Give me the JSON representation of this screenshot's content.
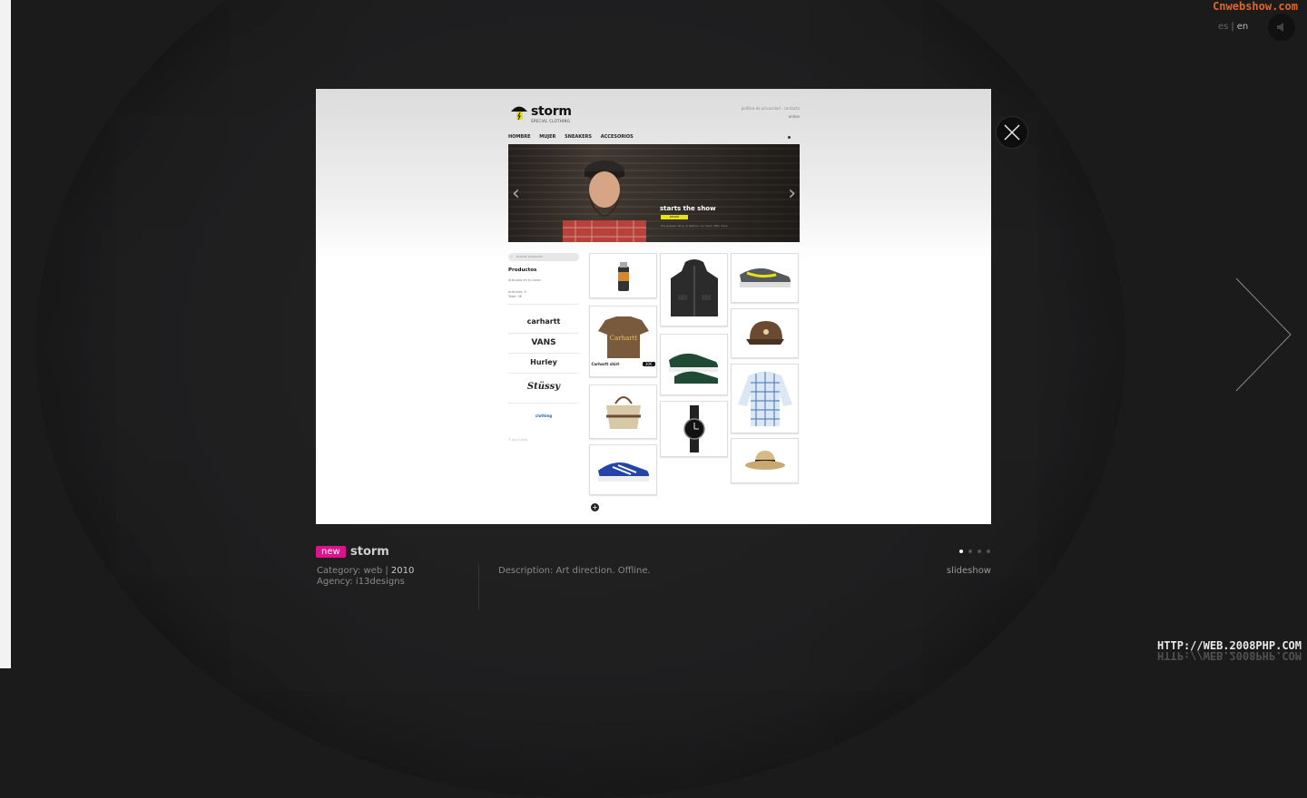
{
  "watermark_top": "Cnwebshow.com",
  "watermark_bottom": "HTTP://WEB.2008PHP.COM",
  "lang": {
    "es": "es",
    "sep": "|",
    "en": "en"
  },
  "icons": {
    "sound": "speaker-icon",
    "close": "close-icon",
    "next": "chevron-right-icon",
    "search": "search-icon",
    "plus": "plus-icon"
  },
  "colors": {
    "accent": "#d8168a",
    "storm_yellow": "#e7e313",
    "background": "#1b1b1c"
  },
  "shot": {
    "logo": "storm",
    "logo_sub": "SPECIAL CLOTHING",
    "toplinks": "política de privacidad · contacto",
    "login": "online",
    "nav": [
      "HOMBRE",
      "MUJER",
      "SNEAKERS",
      "ACCESORIOS"
    ],
    "hero_title": "starts the show",
    "hero_tag": "DESDE",
    "hero_text": "the sneaker shop of fashion, our best, offer more",
    "search_placeholder": "buscar producto",
    "products_heading": "Productos",
    "product_lines": [
      "Artículos en tu carro",
      "Artículos: 0",
      "Total: 0€"
    ],
    "brands": [
      "carhartt",
      "VANS",
      "Hurley",
      "Stüssy",
      "clothing"
    ],
    "tee_label": "Carhartt shirt",
    "tee_price": "30€",
    "footer": "© storm 2010"
  },
  "project": {
    "badge": "new",
    "title": "storm",
    "category_label": "Category: web |",
    "year": "2010",
    "agency": "Agency: i13designs",
    "description": "Description: Art direction. Offline.",
    "slideshow": "slideshow"
  },
  "pager": {
    "count": 4,
    "active": 1
  }
}
